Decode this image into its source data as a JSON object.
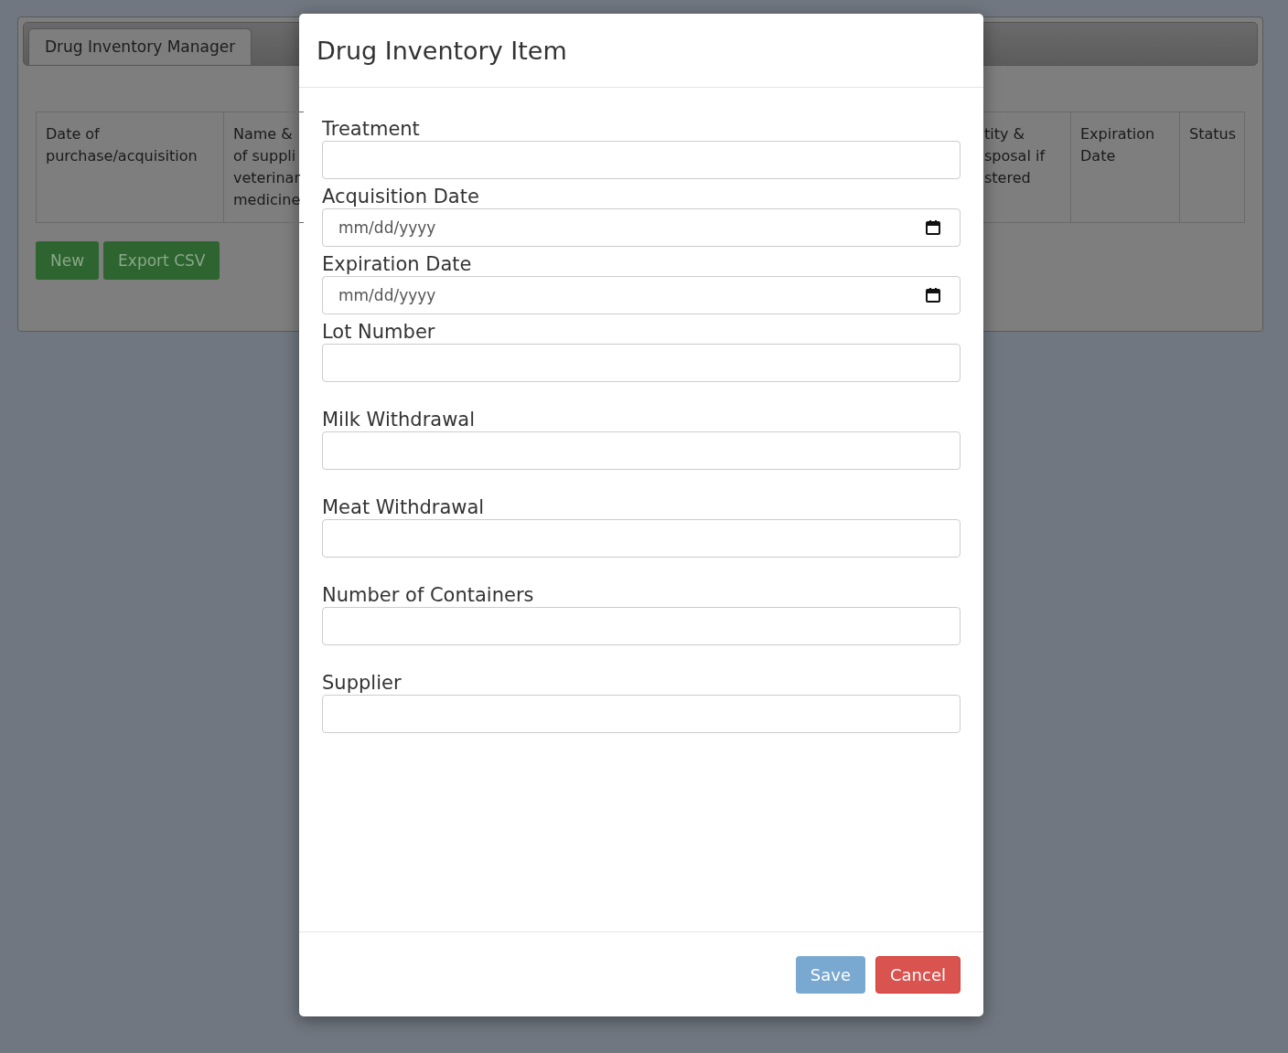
{
  "app_tab": {
    "label": "Drug Inventory Manager",
    "selected": true
  },
  "table": {
    "columns": [
      {
        "label": "Date of purchase/acquisition"
      },
      {
        "label": "Name & of suppli veterinar medicine"
      },
      {
        "label": "tity & sposal if stered"
      },
      {
        "label": "Expiration Date"
      },
      {
        "label": "Status"
      }
    ]
  },
  "actions": [
    "New",
    "Export CSV"
  ],
  "modal": {
    "title": "Drug Inventory Item",
    "fields": [
      {
        "label": "Treatment",
        "kind": "text"
      },
      {
        "label": "Acquisition Date",
        "kind": "date",
        "placeholder": "mm/dd/yyyy"
      },
      {
        "label": "Expiration Date",
        "kind": "date",
        "placeholder": "mm/dd/yyyy"
      },
      {
        "label": "Lot Number",
        "kind": "text"
      },
      {
        "label": "Milk Withdrawal",
        "kind": "text"
      },
      {
        "label": "Meat Withdrawal",
        "kind": "text"
      },
      {
        "label": "Number of Containers",
        "kind": "text"
      },
      {
        "label": "Supplier",
        "kind": "text"
      }
    ],
    "buttons": [
      {
        "label": "Save",
        "kind": "primary",
        "disabled": true
      },
      {
        "label": "Cancel",
        "kind": "danger",
        "disabled": false
      }
    ]
  }
}
